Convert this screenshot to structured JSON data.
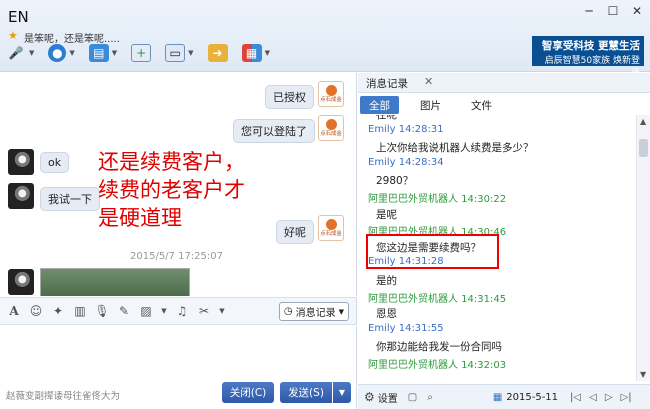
{
  "window": {
    "title": "EN",
    "signature": "是笨呢，还是笨呢.....",
    "controls": [
      "minimize",
      "maximize",
      "close"
    ]
  },
  "ad": {
    "line1": "智享受科技 更慧生活",
    "line2": "启辰智慧50家族  焕新登场"
  },
  "chat": {
    "messages": [
      {
        "side": "right",
        "text": "已授权"
      },
      {
        "side": "right",
        "text": "您可以登陆了"
      },
      {
        "side": "left",
        "text": "ok"
      },
      {
        "side": "left",
        "text": "我试一下"
      },
      {
        "side": "right",
        "text": "好呢"
      }
    ],
    "timestamp": "2015/5/7  17:25:07",
    "annotation": [
      "还是续费客户，",
      "续费的老客户才",
      "是硬道理"
    ],
    "shop_avatar_text": "点石成金"
  },
  "input_toolbar": {
    "icons": [
      "font-icon",
      "emoji-icon",
      "shake-icon",
      "screenshot-icon",
      "voice-icon",
      "edit-icon",
      "image-icon",
      "music-icon",
      "scissors-icon"
    ],
    "record_label": "消息记录"
  },
  "bottom": {
    "promo": "赵薇变副撵诿母往雀佟大为",
    "close_label": "关闭(C)",
    "send_label": "发送(S)"
  },
  "history": {
    "tab": "消息记录",
    "filters": [
      "全部",
      "图片",
      "文件"
    ],
    "active_filter": "全部",
    "items": [
      {
        "type": "text",
        "text": "在呢"
      },
      {
        "type": "header",
        "sender": "Emily",
        "time": "14:28:31",
        "color": "#3b6fc4"
      },
      {
        "type": "text",
        "text": "上次你给我说机器人续费是多少？"
      },
      {
        "type": "header",
        "sender": "Emily",
        "time": "14:28:34",
        "color": "#3b6fc4"
      },
      {
        "type": "text",
        "text": "2980？"
      },
      {
        "type": "header",
        "sender": "阿里巴巴外贸机器人",
        "time": "14:30:22",
        "color": "#2e9a3e"
      },
      {
        "type": "text",
        "text": "是呢"
      },
      {
        "type": "header",
        "sender": "阿里巴巴外贸机器人",
        "time": "14:30:46",
        "color": "#2e9a3e"
      },
      {
        "type": "text",
        "text": "您这边是需要续费吗？"
      },
      {
        "type": "header",
        "sender": "Emily",
        "time": "14:31:28",
        "color": "#3b6fc4"
      },
      {
        "type": "text",
        "text": "是的"
      },
      {
        "type": "header",
        "sender": "阿里巴巴外贸机器人",
        "time": "14:31:45",
        "color": "#2e9a3e"
      },
      {
        "type": "text",
        "text": "恩恩"
      },
      {
        "type": "header",
        "sender": "Emily",
        "time": "14:31:55",
        "color": "#3b6fc4"
      },
      {
        "type": "text",
        "text": "你那边能给我发一份合同吗"
      },
      {
        "type": "header",
        "sender": "阿里巴巴外贸机器人",
        "time": "14:32:03",
        "color": "#2e9a3e"
      }
    ],
    "settings_label": "设置",
    "date": "2015-5-11"
  }
}
